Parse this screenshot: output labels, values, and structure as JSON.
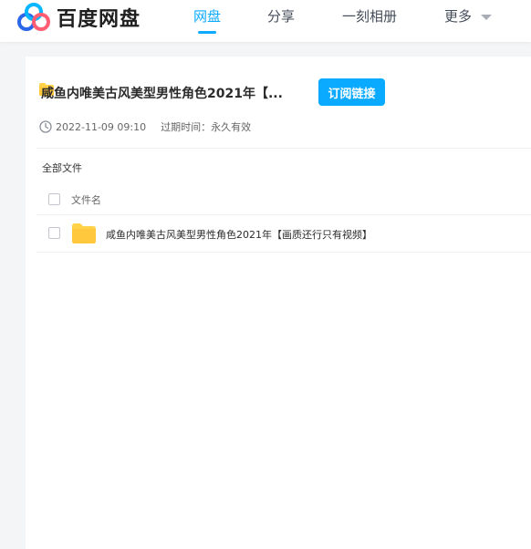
{
  "header": {
    "brand_name": "百度网盘",
    "nav": [
      {
        "label": "网盘",
        "active": true
      },
      {
        "label": "分享",
        "active": false
      },
      {
        "label": "一刻相册",
        "active": false
      },
      {
        "label": "更多",
        "active": false
      }
    ]
  },
  "share": {
    "title": "咸鱼内唯美古风美型男性角色2021年【...",
    "subscribe_label": "订阅链接",
    "timestamp": "2022-11-09 09:10",
    "expiry_label": "过期时间：",
    "expiry_value": "永久有效"
  },
  "file_list": {
    "breadcrumb": "全部文件",
    "column_filename": "文件名",
    "rows": [
      {
        "name": "咸鱼内唯美古风美型男性角色2021年【画质还行只有视频】",
        "type": "folder"
      }
    ]
  },
  "colors": {
    "accent": "#09aaff",
    "folder": "#ffd24a"
  },
  "icons": [
    "cloud-logo-icon",
    "chevron-down-icon",
    "folder-icon",
    "clock-icon"
  ]
}
